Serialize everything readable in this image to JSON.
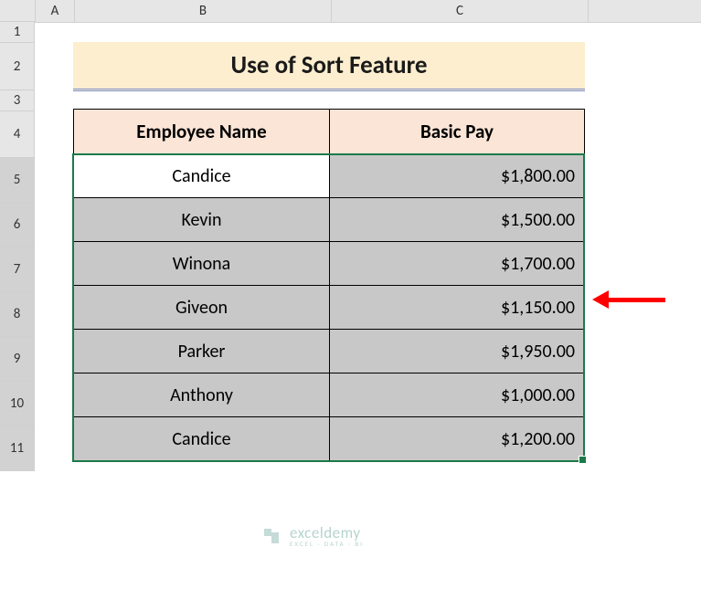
{
  "columns": {
    "a": "A",
    "b": "B",
    "c": "C"
  },
  "rows": {
    "r1": "1",
    "r2": "2",
    "r3": "3",
    "r4": "4",
    "r5": "5",
    "r6": "6",
    "r7": "7",
    "r8": "8",
    "r9": "9",
    "r10": "10",
    "r11": "11"
  },
  "title": "Use of Sort Feature",
  "headers": {
    "name": "Employee Name",
    "pay": "Basic Pay"
  },
  "data": [
    {
      "name": "Candice",
      "pay": "$1,800.00"
    },
    {
      "name": "Kevin",
      "pay": "$1,500.00"
    },
    {
      "name": "Winona",
      "pay": "$1,700.00"
    },
    {
      "name": "Giveon",
      "pay": "$1,150.00"
    },
    {
      "name": "Parker",
      "pay": "$1,950.00"
    },
    {
      "name": "Anthony",
      "pay": "$1,000.00"
    },
    {
      "name": "Candice",
      "pay": "$1,200.00"
    }
  ],
  "watermark": {
    "name": "exceldemy",
    "sub": "EXCEL · DATA · BI"
  },
  "chart_data": {
    "type": "table",
    "title": "Use of Sort Feature",
    "columns": [
      "Employee Name",
      "Basic Pay"
    ],
    "rows": [
      [
        "Candice",
        1800.0
      ],
      [
        "Kevin",
        1500.0
      ],
      [
        "Winona",
        1700.0
      ],
      [
        "Giveon",
        1150.0
      ],
      [
        "Parker",
        1950.0
      ],
      [
        "Anthony",
        1000.0
      ],
      [
        "Candice",
        1200.0
      ]
    ],
    "currency": "USD"
  }
}
